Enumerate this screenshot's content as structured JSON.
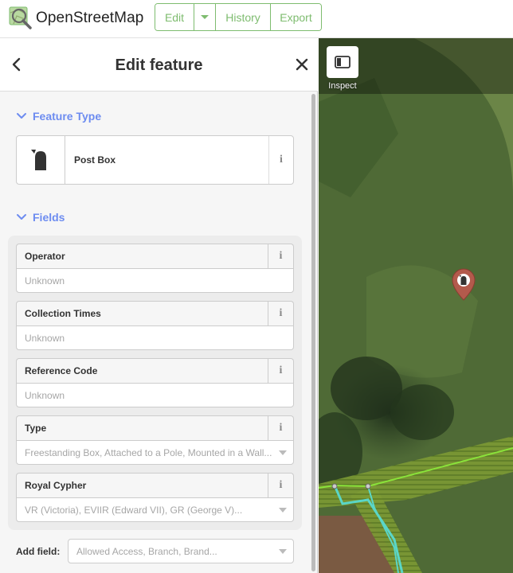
{
  "app": {
    "brand": "OpenStreetMap"
  },
  "toolbar": {
    "edit_label": "Edit",
    "history_label": "History",
    "export_label": "Export"
  },
  "sidebar": {
    "title": "Edit feature",
    "feature_type_heading": "Feature Type",
    "preset_name": "Post Box",
    "fields_heading": "Fields",
    "fields": [
      {
        "label": "Operator",
        "placeholder": "Unknown",
        "dropdown": false
      },
      {
        "label": "Collection Times",
        "placeholder": "Unknown",
        "dropdown": false
      },
      {
        "label": "Reference Code",
        "placeholder": "Unknown",
        "dropdown": false
      },
      {
        "label": "Type",
        "placeholder": "Freestanding Box, Attached to a Pole, Mounted in a Wall...",
        "dropdown": true
      },
      {
        "label": "Royal Cypher",
        "placeholder": "VR (Victoria), EVIIR (Edward VII), GR (George V)...",
        "dropdown": true
      }
    ],
    "add_field_label": "Add field:",
    "add_field_placeholder": "Allowed Access, Branch, Brand..."
  },
  "map": {
    "inspect_label": "Inspect",
    "accent_color": "#7ebc6f",
    "link_color": "#6d8cf0",
    "pin_color": "#b35a4c"
  },
  "icons": {
    "logo": "osm-magnifier-logo",
    "back": "chevron-left-icon",
    "close": "close-icon",
    "preset": "post-box-icon",
    "info": "info-icon",
    "inspect": "inspect-panel-icon"
  }
}
